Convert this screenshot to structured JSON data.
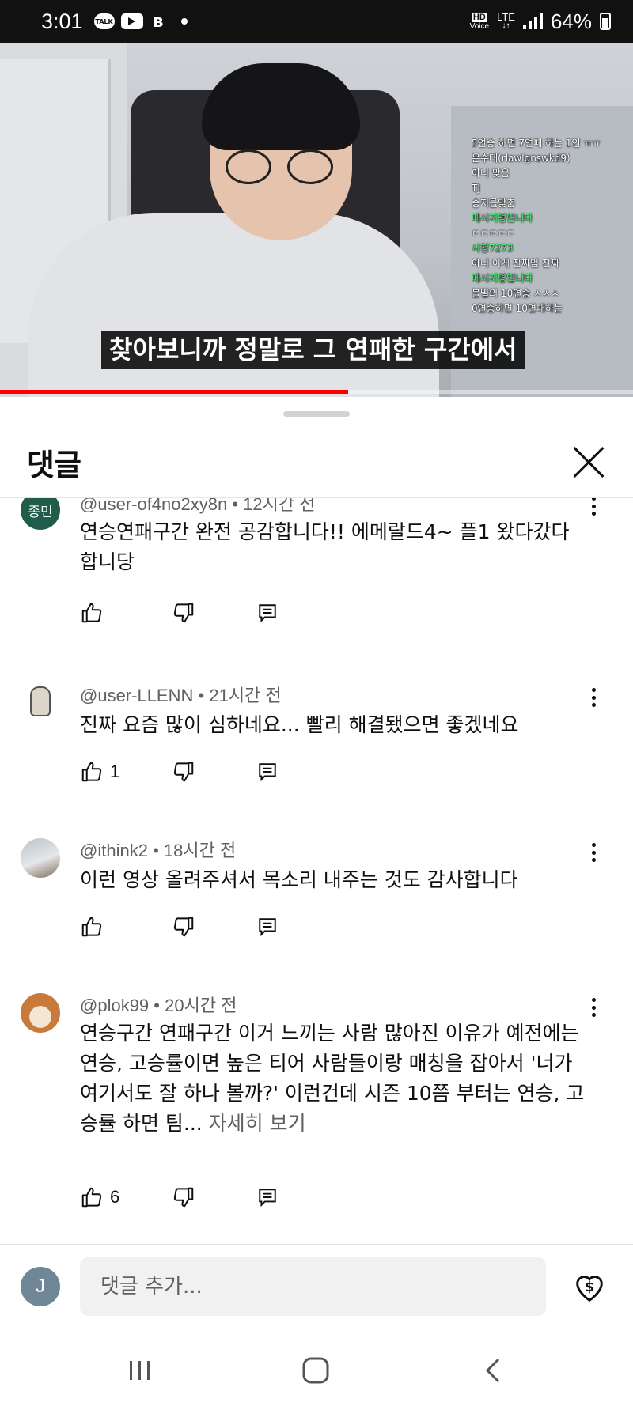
{
  "status_bar": {
    "time": "3:01",
    "app_icons": [
      "talk-icon",
      "youtube-icon",
      "band-icon"
    ],
    "talk_label": "TALK",
    "hd_label": "HD",
    "voice_label": "Voice",
    "network": "LTE",
    "battery": "64%"
  },
  "video": {
    "subtitle": "찾아보니까 정말로 그 연패한 구간에서",
    "chat_lines": [
      "5연승 하면 7연패 하는 1인 ㅠㅠ",
      "온수대(rlawlgnswkd9)",
      "아니 맞음",
      "TJ",
      "승지를맞춤",
      "메시지명입니다",
      "ㄷㄷㄷㄷㄷ",
      "시청7273",
      "아니 이게 진짜임 진짜",
      "메시지명입니다",
      "불멸의 10연승 ㅅㅅㅅ",
      "0연승하면 10연패하는"
    ],
    "progress": 0.55,
    "accent_color": "#ff0000"
  },
  "sheet": {
    "title": "댓글",
    "close_icon": "close-icon"
  },
  "comments": [
    {
      "avatar_text": "종민",
      "author": "@user-of4no2xy8n",
      "time": "12시간 전",
      "text": "연승연패구간 완전 공감합니다!! 에메랄드4~ 플1 왔다갔다합니당",
      "likes": ""
    },
    {
      "author": "@user-LLENN",
      "time": "21시간 전",
      "text": "진짜 요즘 많이 심하네요... 빨리 해결됐으면 좋겠네요",
      "likes": "1"
    },
    {
      "author": "@ithink2",
      "time": "18시간 전",
      "text": "이런 영상 올려주셔서 목소리 내주는 것도 감사합니다",
      "likes": ""
    },
    {
      "author": "@plok99",
      "time": "20시간 전",
      "text": "연승구간 연패구간 이거 느끼는 사람 많아진 이유가 예전에는 연승, 고승률이면 높은 티어 사람들이랑 매칭을 잡아서 '너가 여기서도 잘 하나 볼까?' 이런건데 시즌 10쯤 부터는 연승, 고승률 하면 팀...",
      "more": " 자세히 보기",
      "likes": "6"
    }
  ],
  "composer": {
    "avatar_letter": "J",
    "placeholder": "댓글 추가...",
    "thanks_icon": "super-thanks-icon"
  },
  "nav": {
    "icons": [
      "recent-apps-icon",
      "home-icon",
      "back-icon"
    ]
  }
}
